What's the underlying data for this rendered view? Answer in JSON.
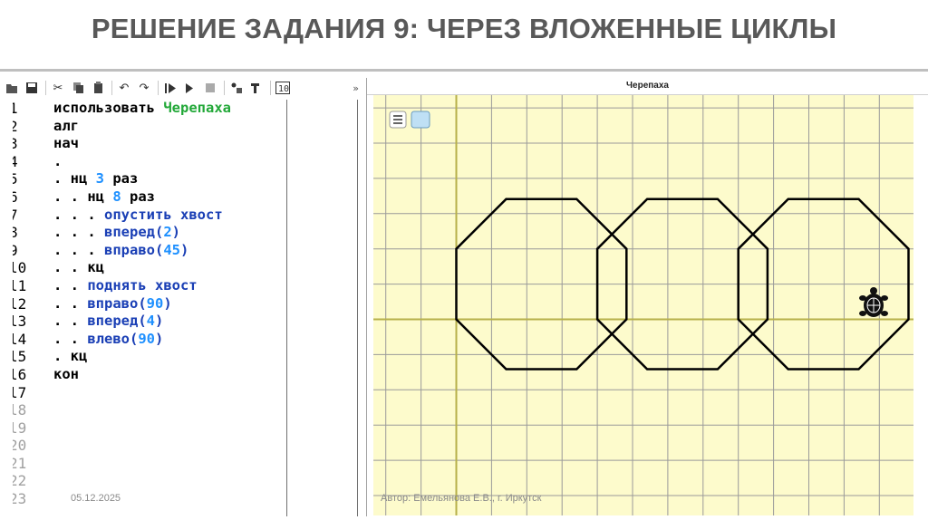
{
  "slide": {
    "title": "РЕШЕНИЕ ЗАДАНИЯ 9: ЧЕРЕЗ ВЛОЖЕННЫЕ ЦИКЛЫ",
    "date": "05.12.2025",
    "author": "Автор: Емельянова Е.В., г. Иркутск"
  },
  "toolbar": {
    "icons": [
      "open-icon",
      "save-icon",
      "cut-icon",
      "copy-icon",
      "paste-icon",
      "undo-icon",
      "redo-icon",
      "run-icon",
      "step-icon",
      "stop-icon",
      "debug-icon",
      "trace-icon",
      "io-icon"
    ],
    "more_label": "»"
  },
  "editor": {
    "line_numbers": [
      "1",
      "2",
      "3",
      "4",
      "5",
      "6",
      "7",
      "8",
      "9",
      "10",
      "11",
      "12",
      "13",
      "14",
      "15",
      "16",
      "17",
      "18",
      "19",
      "20",
      "21",
      "22",
      "23"
    ],
    "line_numbers_visible": [
      "1",
      "2",
      "3",
      "4",
      "5",
      "6",
      "7",
      "8",
      "9",
      "l0",
      "l1",
      "l2",
      "l3",
      "l4",
      "l5",
      "l6",
      "l7",
      "l8",
      "l9",
      "20",
      "21",
      "22",
      "23"
    ],
    "lines": [
      [
        {
          "t": "использовать ",
          "c": ""
        },
        {
          "t": "Черепаха",
          "c": "kw-green"
        }
      ],
      [
        {
          "t": "алг",
          "c": ""
        }
      ],
      [
        {
          "t": "нач",
          "c": ""
        }
      ],
      [
        {
          "t": ".",
          "c": ""
        }
      ],
      [
        {
          "t": ". нц ",
          "c": ""
        },
        {
          "t": "3",
          "c": "kw-num"
        },
        {
          "t": " раз",
          "c": ""
        }
      ],
      [
        {
          "t": ". . нц ",
          "c": ""
        },
        {
          "t": "8",
          "c": "kw-num"
        },
        {
          "t": " раз",
          "c": ""
        }
      ],
      [
        {
          "t": ". . . ",
          "c": ""
        },
        {
          "t": "опустить хвост",
          "c": "kw-cmd"
        }
      ],
      [
        {
          "t": ". . . ",
          "c": ""
        },
        {
          "t": "вперед(",
          "c": "kw-cmd"
        },
        {
          "t": "2",
          "c": "kw-num"
        },
        {
          "t": ")",
          "c": "kw-cmd"
        }
      ],
      [
        {
          "t": ". . . ",
          "c": ""
        },
        {
          "t": "вправо(",
          "c": "kw-cmd"
        },
        {
          "t": "45",
          "c": "kw-num"
        },
        {
          "t": ")",
          "c": "kw-cmd"
        }
      ],
      [
        {
          "t": ". . кц",
          "c": ""
        }
      ],
      [
        {
          "t": ". . ",
          "c": ""
        },
        {
          "t": "поднять хвост",
          "c": "kw-cmd"
        }
      ],
      [
        {
          "t": ". . ",
          "c": ""
        },
        {
          "t": "вправо(",
          "c": "kw-cmd"
        },
        {
          "t": "90",
          "c": "kw-num"
        },
        {
          "t": ")",
          "c": "kw-cmd"
        }
      ],
      [
        {
          "t": ". . ",
          "c": ""
        },
        {
          "t": "вперед(",
          "c": "kw-cmd"
        },
        {
          "t": "4",
          "c": "kw-num"
        },
        {
          "t": ")",
          "c": "kw-cmd"
        }
      ],
      [
        {
          "t": ". . ",
          "c": ""
        },
        {
          "t": "влево(",
          "c": "kw-cmd"
        },
        {
          "t": "90",
          "c": "kw-num"
        },
        {
          "t": ")",
          "c": "kw-cmd"
        }
      ],
      [
        {
          "t": ". кц",
          "c": ""
        }
      ],
      [
        {
          "t": "кон",
          "c": ""
        }
      ]
    ]
  },
  "turtle_panel": {
    "title": "Черепаха",
    "menu_icon": "menu-icon",
    "color_swatch": "#bfe0f5",
    "background": "#fdfbcc",
    "grid_color": "#9a9a9a",
    "axis_color": "#b7b04a",
    "turtle_icon": "turtle-icon"
  }
}
